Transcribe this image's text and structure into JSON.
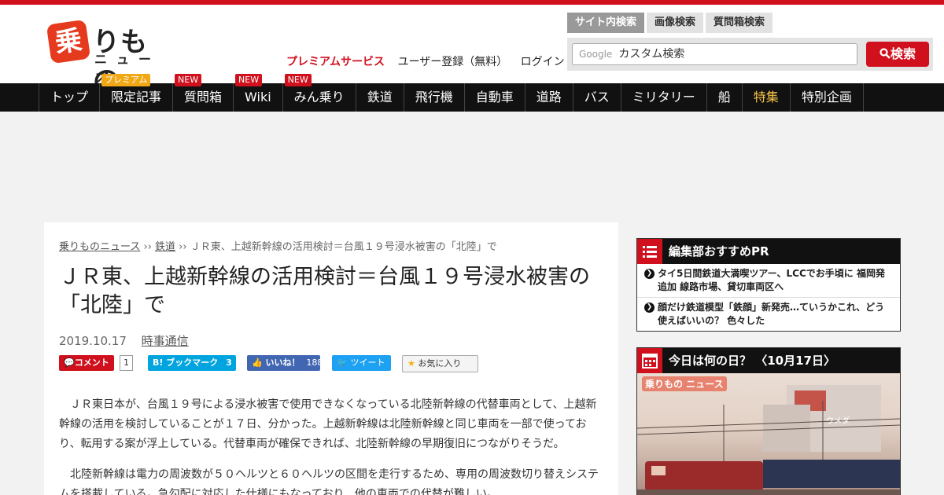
{
  "brand": {
    "logo_badge": "乗",
    "logo_main": "りもの",
    "logo_sub": "ニュース"
  },
  "header": {
    "premium_service": "プレミアムサービス",
    "register": "ユーザー登録（無料）",
    "login": "ログイン"
  },
  "search": {
    "tabs": [
      "サイト内検索",
      "画像検索",
      "質問箱検索"
    ],
    "google_label": "Google",
    "placeholder": "カスタム検索",
    "button_label": "検索"
  },
  "nav": {
    "items": [
      {
        "label": "トップ"
      },
      {
        "label": "限定記事",
        "badge": "プレミアム"
      },
      {
        "label": "質問箱",
        "badge": "NEW"
      },
      {
        "label": "Wiki",
        "badge": "NEW"
      },
      {
        "label": "みん乗り",
        "badge": "NEW"
      },
      {
        "label": "鉄道"
      },
      {
        "label": "飛行機"
      },
      {
        "label": "自動車"
      },
      {
        "label": "道路"
      },
      {
        "label": "バス"
      },
      {
        "label": "ミリタリー"
      },
      {
        "label": "船"
      },
      {
        "label": "特集"
      },
      {
        "label": "特別企画"
      }
    ]
  },
  "breadcrumb": {
    "home": "乗りものニュース",
    "sep1": "››",
    "category": "鉄道",
    "sep2": "››",
    "current": "ＪＲ東、上越新幹線の活用検討＝台風１９号浸水被害の「北陸」で"
  },
  "article": {
    "title": "ＪＲ東、上越新幹線の活用検討＝台風１９号浸水被害の「北陸」で",
    "date": "2019.10.17",
    "source": "時事通信",
    "paragraphs": [
      "ＪＲ東日本が、台風１９号による浸水被害で使用できなくなっている北陸新幹線の代替車両として、上越新幹線の活用を検討していることが１７日、分かった。上越新幹線は北陸新幹線と同じ車両を一部で使っており、転用する案が浮上している。代替車両が確保できれば、北陸新幹線の早期復旧につながりそうだ。",
      "北陸新幹線は電力の周波数が５０ヘルツと６０ヘルツの区間を走行するため、専用の周波数切り替えシステムを搭載している。急勾配に対応した仕様にもなっており、他の車両での代替が難しい。"
    ]
  },
  "social": {
    "comment_label": "コメント",
    "comment_count": "1",
    "hatena_label": "ブックマーク",
    "hatena_count": "3",
    "fb_label": "いいね！",
    "fb_count": "188",
    "tweet_label": "ツイート",
    "fav_label": "お気に入り"
  },
  "sidebar": {
    "pr_title": "編集部おすすめPR",
    "pr_items": [
      "タイ5日間鉄道大満喫ツアー、LCCでお手頃に 福岡発追加 線路市場、貸切車両区へ",
      "顔だけ鉄道模型「鉄顔」新発売…ていうかこれ、どう使えばいいの？ 色々した"
    ],
    "today_title": "今日は何の日？ 〈10月17日〉",
    "today_logo": "乗りもの ニュース",
    "today_sign": "ウメダ"
  },
  "colors": {
    "brand_red": "#d0101d",
    "nav_bg": "#111111",
    "feature_gold": "#f6c24a",
    "premium_orange": "#f1a816"
  }
}
